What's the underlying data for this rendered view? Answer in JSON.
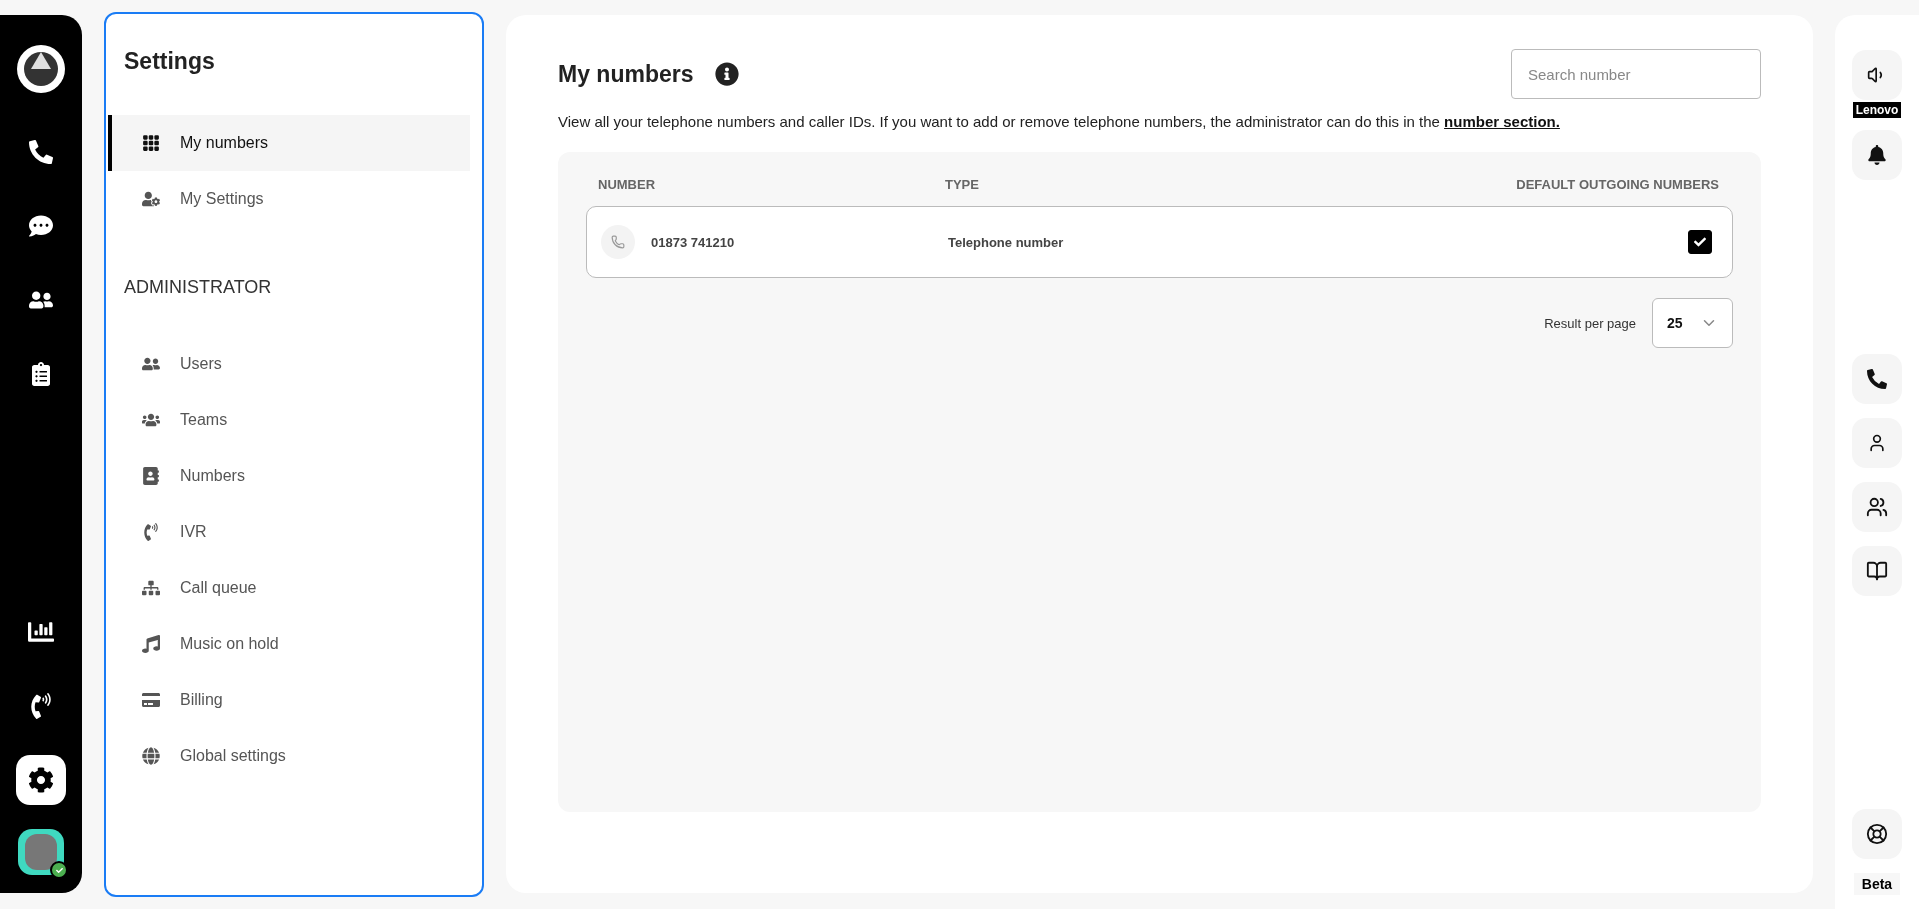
{
  "nav_items": [
    {
      "selected": false
    },
    {
      "selected": false
    },
    {
      "selected": false
    },
    {
      "selected": false
    },
    {
      "selected": false
    },
    {
      "selected": false
    },
    {
      "selected": true
    }
  ],
  "avatar": {
    "online": true
  },
  "settings": {
    "title": "Settings",
    "personal_items": [
      {
        "label": "My numbers",
        "selected": true
      },
      {
        "label": "My Settings",
        "selected": false
      }
    ],
    "admin_heading": "ADMINISTRATOR",
    "admin_items": [
      {
        "label": "Users",
        "selected": false
      },
      {
        "label": "Teams",
        "selected": false
      },
      {
        "label": "Numbers",
        "selected": false
      },
      {
        "label": "IVR",
        "selected": false
      },
      {
        "label": "Call queue",
        "selected": false
      },
      {
        "label": "Music on hold",
        "selected": false
      },
      {
        "label": "Billing",
        "selected": false
      },
      {
        "label": "Global settings",
        "selected": false
      }
    ]
  },
  "main": {
    "title": "My numbers",
    "search": {
      "placeholder": "Search number"
    },
    "description": "View all your telephone numbers and caller IDs. If you want to add or remove telephone numbers, the administrator can do this in the",
    "link": "number section.",
    "table": {
      "columns": [
        "NUMBER",
        "TYPE",
        "DEFAULT OUTGOING NUMBERS"
      ],
      "rows": [
        {
          "number": "01873 741210",
          "type": "Telephone number",
          "default": true
        }
      ]
    },
    "pagination": {
      "label": "Result per page",
      "value": "25"
    }
  },
  "right_bar": {
    "device_label": "Lenovo",
    "beta": "Beta"
  }
}
